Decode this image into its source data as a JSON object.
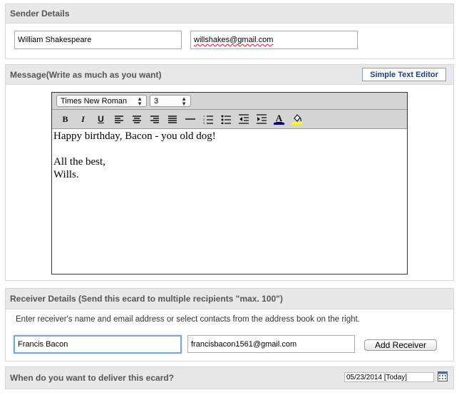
{
  "sender": {
    "title": "Sender Details",
    "name_value": "William Shakespeare",
    "email_value": "willshakes@gmail.com"
  },
  "message": {
    "title": "Message(Write as much as you want)",
    "simple_editor_label": "Simple Text Editor",
    "font_family": "Times New Roman",
    "font_size": "3",
    "toolbar": [
      {
        "name": "bold-icon",
        "glyph": "B"
      },
      {
        "name": "italic-icon",
        "glyph": "I"
      },
      {
        "name": "underline-icon",
        "glyph": "U"
      },
      {
        "name": "align-left-icon",
        "glyph": ""
      },
      {
        "name": "align-center-icon",
        "glyph": ""
      },
      {
        "name": "align-right-icon",
        "glyph": ""
      },
      {
        "name": "justify-icon",
        "glyph": ""
      },
      {
        "name": "horizontal-rule-icon",
        "glyph": ""
      },
      {
        "name": "ordered-list-icon",
        "glyph": ""
      },
      {
        "name": "unordered-list-icon",
        "glyph": ""
      },
      {
        "name": "outdent-icon",
        "glyph": ""
      },
      {
        "name": "indent-icon",
        "glyph": ""
      },
      {
        "name": "text-color-icon",
        "glyph": "A"
      },
      {
        "name": "background-color-icon",
        "glyph": ""
      }
    ],
    "lines": [
      "Happy birthday, Bacon - you old dog!",
      "",
      "All the best,",
      "Wills."
    ]
  },
  "receiver": {
    "title": "Receiver Details (Send this ecard to multiple recipients \"max. 100\")",
    "instructions": "Enter receiver's name and email address or select contacts from the address book on the right.",
    "name_value": "Francis Bacon",
    "email_value": "francisbacon1561@gmail.com",
    "add_label": "Add Receiver"
  },
  "delivery": {
    "title": "When do you want to deliver this ecard?",
    "date_value": "05/23/2014 [Today]"
  },
  "colors": {
    "header_bg": "#e8e8e8",
    "link_blue": "#1f3f7a",
    "focus_border": "#7aa7d8",
    "highlight_yellow": "#ffff00",
    "text_color_bar": "#000080"
  }
}
